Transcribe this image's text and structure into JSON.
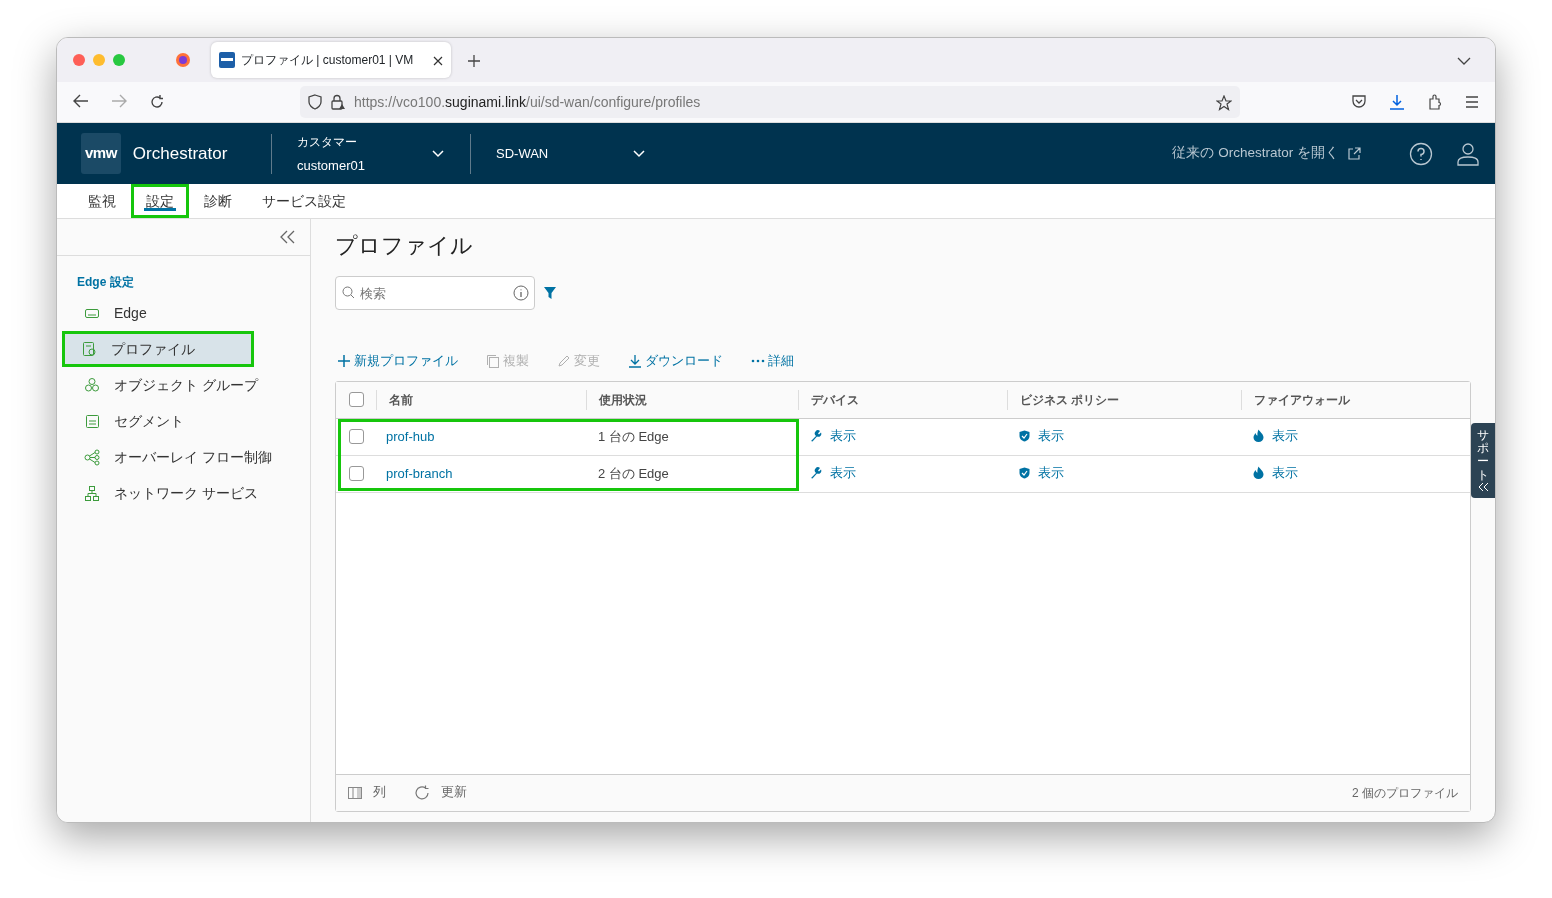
{
  "browser": {
    "tab_title": "プロファイル | customer01 | VM",
    "url_prefix": "https://vco100.",
    "url_domain": "suginami.link",
    "url_path": "/ui/sd-wan/configure/profiles"
  },
  "header": {
    "logo": "vmw",
    "app": "Orchestrator",
    "customer_label": "カスタマー",
    "customer": "customer01",
    "service": "SD-WAN",
    "legacy_link": "従来の Orchestrator を開く"
  },
  "nav_tabs": [
    {
      "label": "監視",
      "selected": false,
      "highlighted": false
    },
    {
      "label": "設定",
      "selected": true,
      "highlighted": true
    },
    {
      "label": "診断",
      "selected": false,
      "highlighted": false
    },
    {
      "label": "サービス設定",
      "selected": false,
      "highlighted": false
    }
  ],
  "sidebar": {
    "section": "Edge 設定",
    "items": [
      {
        "label": "Edge",
        "kind": "edge",
        "selected": false,
        "highlighted": false
      },
      {
        "label": "プロファイル",
        "kind": "profile",
        "selected": true,
        "highlighted": true
      },
      {
        "label": "オブジェクト グループ",
        "kind": "objects",
        "selected": false,
        "highlighted": false
      },
      {
        "label": "セグメント",
        "kind": "segment",
        "selected": false,
        "highlighted": false
      },
      {
        "label": "オーバーレイ フロー制御",
        "kind": "flow",
        "selected": false,
        "highlighted": false
      },
      {
        "label": "ネットワーク サービス",
        "kind": "network",
        "selected": false,
        "highlighted": false
      }
    ]
  },
  "page_title": "プロファイル",
  "search": {
    "placeholder": "検索"
  },
  "actions": [
    {
      "label": "新規プロファイル",
      "kind": "plus",
      "disabled": false
    },
    {
      "label": "複製",
      "kind": "copy",
      "disabled": true
    },
    {
      "label": "変更",
      "kind": "pencil",
      "disabled": true
    },
    {
      "label": "ダウンロード",
      "kind": "download",
      "disabled": false
    },
    {
      "label": "詳細",
      "kind": "dots",
      "disabled": false
    }
  ],
  "table": {
    "highlight": true,
    "all_checked": false,
    "columns": [
      "名前",
      "使用状況",
      "デバイス",
      "ビジネス ポリシー",
      "ファイアウォール"
    ],
    "rows": [
      {
        "checked": false,
        "name": "prof-hub",
        "usage": "1 台の Edge",
        "device": "表示",
        "policy": "表示",
        "firewall": "表示"
      },
      {
        "checked": false,
        "name": "prof-branch",
        "usage": "2 台の Edge",
        "device": "表示",
        "policy": "表示",
        "firewall": "表示"
      }
    ]
  },
  "footer": {
    "columns": "列",
    "refresh": "更新",
    "count": "2 個のプロファイル"
  },
  "support": "サポート"
}
